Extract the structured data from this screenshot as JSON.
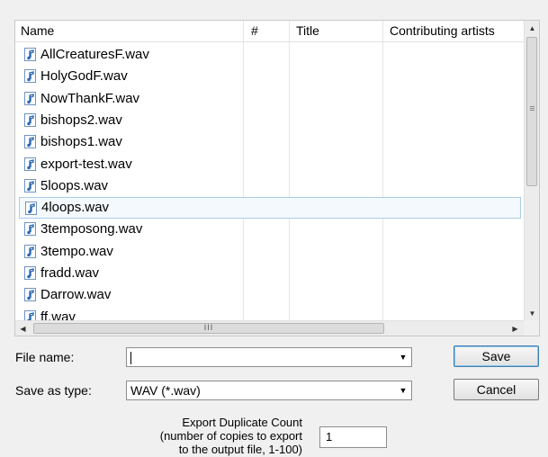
{
  "columns": {
    "name": "Name",
    "number": "#",
    "title": "Title",
    "contributing_artists": "Contributing artists"
  },
  "files": [
    {
      "name": "AllCreaturesF.wav"
    },
    {
      "name": "HolyGodF.wav"
    },
    {
      "name": "NowThankF.wav"
    },
    {
      "name": "bishops2.wav"
    },
    {
      "name": "bishops1.wav"
    },
    {
      "name": "export-test.wav"
    },
    {
      "name": "5loops.wav"
    },
    {
      "name": "4loops.wav",
      "selected": true
    },
    {
      "name": "3temposong.wav"
    },
    {
      "name": "3tempo.wav"
    },
    {
      "name": "fradd.wav"
    },
    {
      "name": "Darrow.wav"
    },
    {
      "name": "ff.wav"
    }
  ],
  "hscroll": {
    "thumb_label": "III"
  },
  "form": {
    "file_name_label": "File name:",
    "file_name_value": "",
    "save_as_type_label": "Save as type:",
    "save_as_type_value": "WAV (*.wav)",
    "save_label": "Save",
    "cancel_label": "Cancel"
  },
  "duplicate": {
    "line1": "Export Duplicate Count",
    "line2": "(number of copies to export",
    "line3": "to the output file, 1-100)",
    "value": "1"
  },
  "icons": {
    "file": "audio-file-icon",
    "dropdown": "chevron-down-icon"
  }
}
